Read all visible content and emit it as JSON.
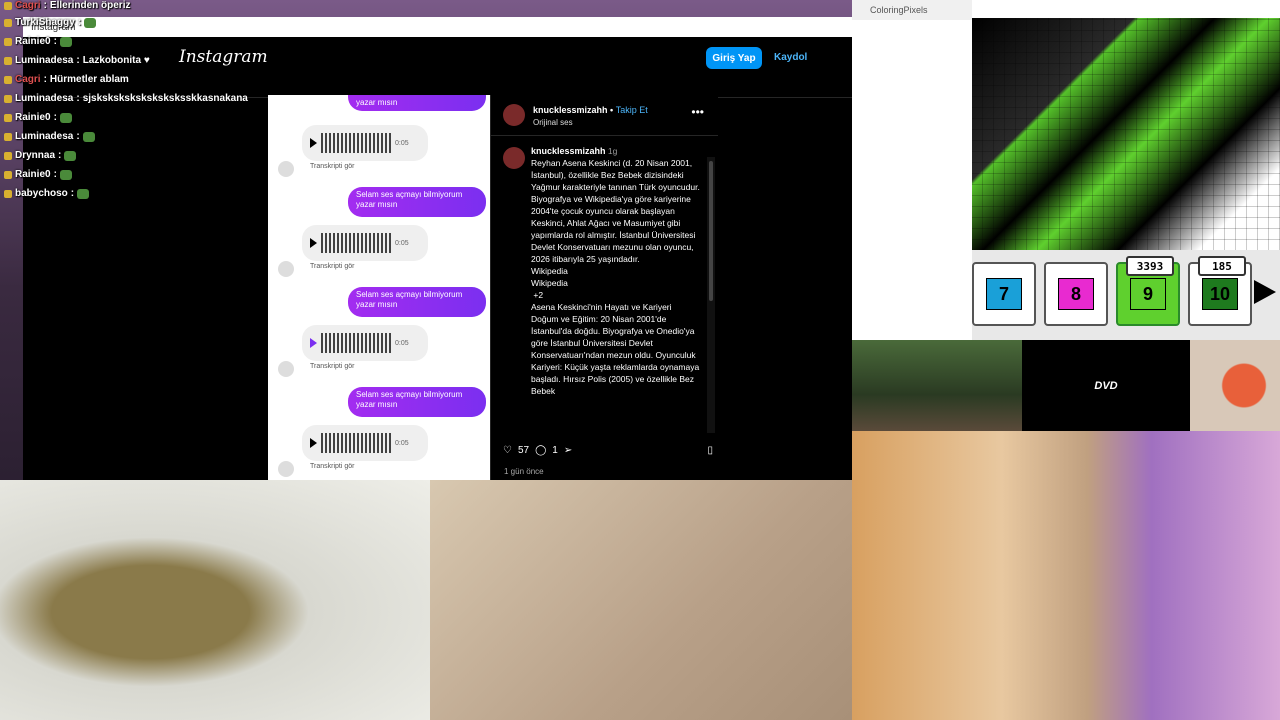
{
  "chat": {
    "messages": [
      {
        "user": "Cagri",
        "text": "Ellerinden öperiz",
        "user_color": "#e05050"
      },
      {
        "user": "TurkiShaggy",
        "text": "",
        "user_color": "#ffffff"
      },
      {
        "user": "Rainie0",
        "text": "",
        "user_color": "#ffffff"
      },
      {
        "user": "Luminadesa",
        "text": "Lazkobonita ♥",
        "user_color": "#ffffff"
      },
      {
        "user": "Cagri",
        "text": "Hürmetler ablam",
        "user_color": "#e05050"
      },
      {
        "user": "Luminadesa",
        "text": "sjsksksksksksksksksskkasnakana",
        "user_color": "#ffffff"
      },
      {
        "user": "Rainie0",
        "text": "",
        "user_color": "#ffffff"
      },
      {
        "user": "Luminadesa",
        "text": "",
        "user_color": "#ffffff"
      },
      {
        "user": "Drynnaa",
        "text": "",
        "user_color": "#ffffff"
      },
      {
        "user": "Rainie0",
        "text": "",
        "user_color": "#ffffff"
      },
      {
        "user": "babychoso",
        "text": "",
        "user_color": "#ffffff"
      }
    ]
  },
  "instagram": {
    "window_title": "Instagram",
    "logo": "Instagram",
    "login_label": "Giriş Yap",
    "signup_label": "Kaydol",
    "dm_bubble_text": "Selam ses açmayı bilmiyorum yazar mısın",
    "dm_bubble_top_text": "yazar mısın",
    "voice_duration": "0:05",
    "transcript_label": "Transkripti gör",
    "post_user": "knucklessmizahh",
    "follow_label": "Takip Et",
    "audio_label": "Orijinal ses",
    "caption_user": "knucklessmizahh",
    "caption_time": "1g",
    "caption_text": "Reyhan Asena Keskinci (d. 20 Nisan 2001, İstanbul), özellikle Bez Bebek dizisindeki Yağmur karakteriyle tanınan Türk oyuncudur. Biyografya ve Wikipedia'ya göre kariyerine 2004'te çocuk oyuncu olarak başlayan Keskinci, Ahlat Ağacı ve Masumiyet gibi yapımlarda rol almıştır. İstanbul Üniversitesi Devlet Konservatuarı mezunu olan oyuncu, 2026 itibarıyla 25 yaşındadır.",
    "caption_links": [
      "Wikipedia",
      "Wikipedia",
      "+2"
    ],
    "caption_text2": "Asena Keskinci'nin Hayatı ve Kariyeri Doğum ve Eğitim: 20 Nisan 2001'de İstanbul'da doğdu. Biyografya ve Onedio'ya göre İstanbul Üniversitesi Devlet Konservatuarı'ndan mezun oldu. Oyunculuk Kariyeri: Küçük yaşta reklamlarda oynamaya başladı. Hırsız Polis (2005) ve özellikle Bez Bebek",
    "likes": "57",
    "comments": "1",
    "posted": "1 gün önce"
  },
  "coloring": {
    "window_title": "ColoringPixels",
    "palette": [
      {
        "number": "7",
        "color": "#1aa0d8",
        "badge": ""
      },
      {
        "number": "8",
        "color": "#e82ad0",
        "badge": ""
      },
      {
        "number": "9",
        "color": "#5fd02e",
        "badge": "3393"
      },
      {
        "number": "10",
        "color": "#1e7a1e",
        "badge": "185"
      }
    ]
  },
  "tiles": {
    "dvd_label": "DVD"
  },
  "colors": {
    "accent_blue": "#0095f6",
    "link_blue": "#4cb5f9",
    "green_pixel": "#5fd02e"
  }
}
